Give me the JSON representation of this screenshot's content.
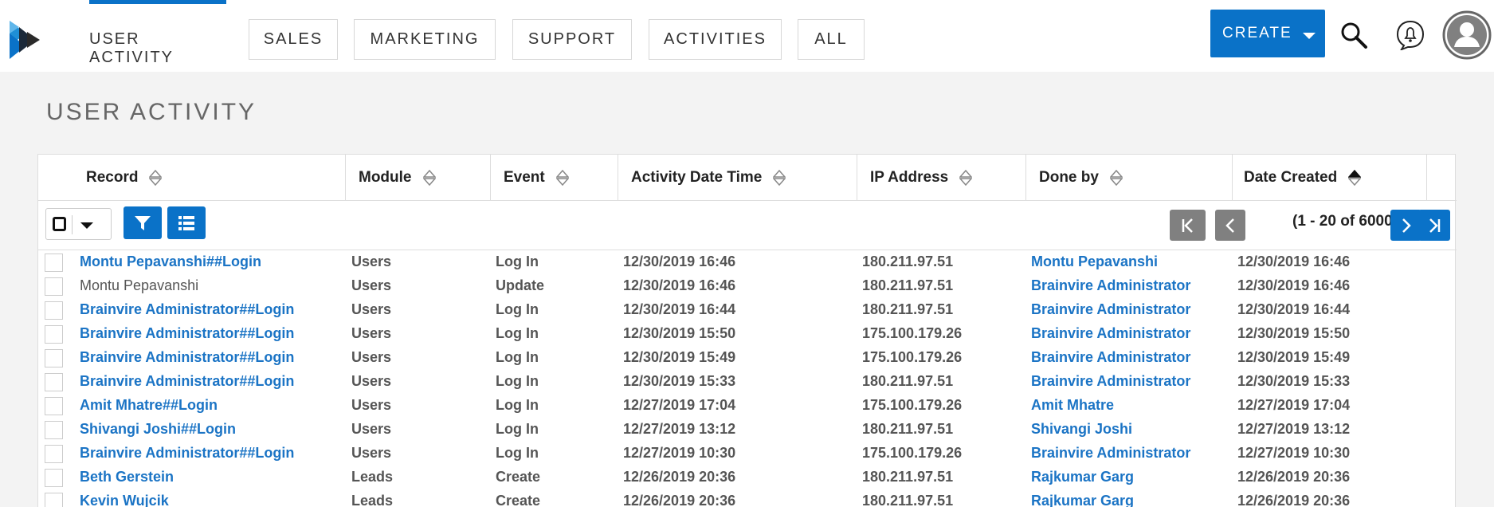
{
  "nav": {
    "active": "USER ACTIVITY",
    "tabs": [
      "SALES",
      "MARKETING",
      "SUPPORT",
      "ACTIVITIES",
      "ALL"
    ],
    "create_label": "CREATE",
    "accent_color": "#0a72c8"
  },
  "page": {
    "title": "USER ACTIVITY"
  },
  "table": {
    "columns": [
      "Record",
      "Module",
      "Event",
      "Activity Date Time",
      "IP Address",
      "Done by",
      "Date Created"
    ],
    "sorted_column": "Date Created",
    "pagination": "(1 - 20 of 6000)",
    "rows": [
      {
        "record": "Montu Pepavanshi##Login",
        "record_link": true,
        "module": "Users",
        "event": "Log In",
        "activity": "12/30/2019 16:46",
        "ip": "180.211.97.51",
        "done_by": "Montu Pepavanshi",
        "created": "12/30/2019 16:46"
      },
      {
        "record": "Montu Pepavanshi",
        "record_link": false,
        "module": "Users",
        "event": "Update",
        "activity": "12/30/2019 16:46",
        "ip": "180.211.97.51",
        "done_by": "Brainvire Administrator",
        "created": "12/30/2019 16:46"
      },
      {
        "record": "Brainvire Administrator##Login",
        "record_link": true,
        "module": "Users",
        "event": "Log In",
        "activity": "12/30/2019 16:44",
        "ip": "180.211.97.51",
        "done_by": "Brainvire Administrator",
        "created": "12/30/2019 16:44"
      },
      {
        "record": "Brainvire Administrator##Login",
        "record_link": true,
        "module": "Users",
        "event": "Log In",
        "activity": "12/30/2019 15:50",
        "ip": "175.100.179.26",
        "done_by": "Brainvire Administrator",
        "created": "12/30/2019 15:50"
      },
      {
        "record": "Brainvire Administrator##Login",
        "record_link": true,
        "module": "Users",
        "event": "Log In",
        "activity": "12/30/2019 15:49",
        "ip": "175.100.179.26",
        "done_by": "Brainvire Administrator",
        "created": "12/30/2019 15:49"
      },
      {
        "record": "Brainvire Administrator##Login",
        "record_link": true,
        "module": "Users",
        "event": "Log In",
        "activity": "12/30/2019 15:33",
        "ip": "180.211.97.51",
        "done_by": "Brainvire Administrator",
        "created": "12/30/2019 15:33"
      },
      {
        "record": "Amit Mhatre##Login",
        "record_link": true,
        "module": "Users",
        "event": "Log In",
        "activity": "12/27/2019 17:04",
        "ip": "175.100.179.26",
        "done_by": "Amit Mhatre",
        "created": "12/27/2019 17:04"
      },
      {
        "record": "Shivangi Joshi##Login",
        "record_link": true,
        "module": "Users",
        "event": "Log In",
        "activity": "12/27/2019 13:12",
        "ip": "180.211.97.51",
        "done_by": "Shivangi Joshi",
        "created": "12/27/2019 13:12"
      },
      {
        "record": "Brainvire Administrator##Login",
        "record_link": true,
        "module": "Users",
        "event": "Log In",
        "activity": "12/27/2019 10:30",
        "ip": "175.100.179.26",
        "done_by": "Brainvire Administrator",
        "created": "12/27/2019 10:30"
      },
      {
        "record": "Beth Gerstein",
        "record_link": true,
        "module": "Leads",
        "event": "Create",
        "activity": "12/26/2019 20:36",
        "ip": "180.211.97.51",
        "done_by": "Rajkumar Garg",
        "created": "12/26/2019 20:36"
      },
      {
        "record": "Kevin Wujcik",
        "record_link": true,
        "module": "Leads",
        "event": "Create",
        "activity": "12/26/2019 20:36",
        "ip": "180.211.97.51",
        "done_by": "Rajkumar Garg",
        "created": "12/26/2019 20:36"
      }
    ]
  }
}
